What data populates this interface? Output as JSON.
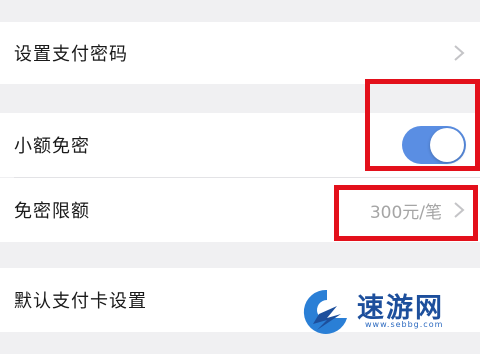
{
  "settings": {
    "payment_password": {
      "label": "设置支付密码"
    },
    "small_amount_free": {
      "label": "小额免密",
      "enabled": true
    },
    "free_limit": {
      "label": "免密限额",
      "value": "300元/笔"
    },
    "default_card": {
      "label": "默认支付卡设置"
    }
  },
  "watermark": {
    "brand": "速游网",
    "url": "www.sebbg.com"
  },
  "colors": {
    "accent": "#5a8ee3",
    "highlight": "#e3101b",
    "watermark": "#1d4f9c"
  }
}
